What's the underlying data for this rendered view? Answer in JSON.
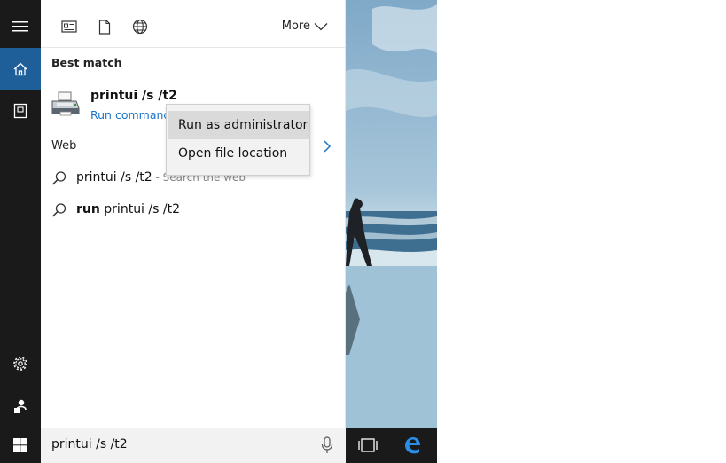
{
  "filter_bar": {
    "icons": [
      "apps-filter-icon",
      "documents-filter-icon",
      "web-filter-icon"
    ],
    "more_label": "More"
  },
  "best_match": {
    "header": "Best match",
    "title": "printui /s /t2",
    "subtitle": "Run command"
  },
  "web": {
    "header": "Web",
    "results": [
      {
        "query": "printui /s /t2",
        "hint": " - Search the web"
      },
      {
        "bold": "run",
        "query": " printui /s /t2"
      }
    ]
  },
  "context_menu": {
    "items": [
      "Run as administrator",
      "Open file location"
    ]
  },
  "search_box": {
    "value": "printui /s /t2"
  },
  "rail": {
    "icons": [
      "hamburger-icon",
      "home-icon",
      "notebook-icon",
      "settings-icon",
      "feedback-icon"
    ]
  },
  "taskbar": {
    "icons": [
      "windows-start-icon",
      "task-view-icon",
      "edge-icon"
    ]
  },
  "colors": {
    "accent": "#1e5f9a",
    "link": "#1a73c9",
    "rail": "#1a1a1a"
  }
}
